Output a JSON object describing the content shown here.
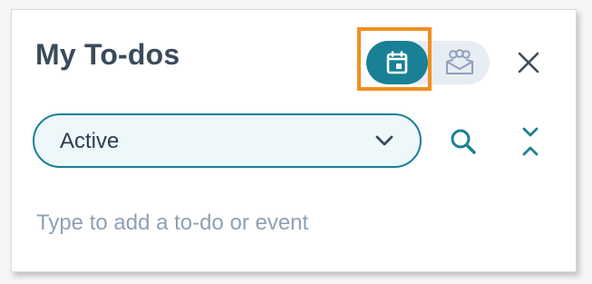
{
  "header": {
    "title": "My To-dos"
  },
  "view_toggle": {
    "active": "calendar",
    "options": [
      {
        "icon": "calendar-icon"
      },
      {
        "icon": "team-icon"
      }
    ]
  },
  "filter": {
    "selected": "Active"
  },
  "add_todo": {
    "placeholder": "Type to add a to-do or event",
    "value": ""
  },
  "colors": {
    "accent": "#1a8095",
    "highlight": "#f28e1f",
    "title": "#3a4a5a",
    "placeholder": "#8fa1b3"
  }
}
